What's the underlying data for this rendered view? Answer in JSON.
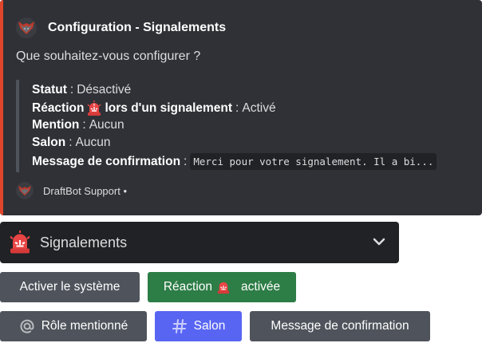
{
  "embed": {
    "accent_color": "#e0452b",
    "author_name": "Configuration - Signalements",
    "author_icon": "wolf-head-logo-icon",
    "description": "Que souhaitez-vous configurer ?",
    "fields": {
      "statut": {
        "name": "Statut",
        "value": "Désactivé"
      },
      "reaction": {
        "name_before": "Réaction",
        "icon": "rotating-light-emoji-icon",
        "name_after": "lors d'un signalement",
        "value": "Activé"
      },
      "mention": {
        "name": "Mention",
        "value": "Aucun"
      },
      "salon": {
        "name": "Salon",
        "value": "Aucun"
      },
      "message": {
        "name": "Message de confirmation",
        "value": "Merci pour votre signalement. Il a bi..."
      }
    },
    "separator": ":",
    "footer": {
      "text": "DraftBot Support •",
      "icon": "wolf-head-logo-icon"
    }
  },
  "select_menu": {
    "icon": "rotating-light-emoji-icon",
    "label": "Signalements",
    "chevron_icon": "chevron-down-icon"
  },
  "buttons": {
    "activer": {
      "label": "Activer le système",
      "color": "#4f545c"
    },
    "reaction": {
      "label_before": "Réaction",
      "icon": "rotating-light-emoji-icon",
      "label_after": "activée",
      "color": "#2d7d46"
    },
    "role": {
      "icon": "at-sign-icon",
      "label": "Rôle mentionné",
      "color": "#4f545c"
    },
    "salon": {
      "icon": "hash-icon",
      "label": "Salon",
      "color": "#5865f2"
    },
    "message": {
      "label": "Message de confirmation",
      "color": "#4f545c"
    }
  }
}
